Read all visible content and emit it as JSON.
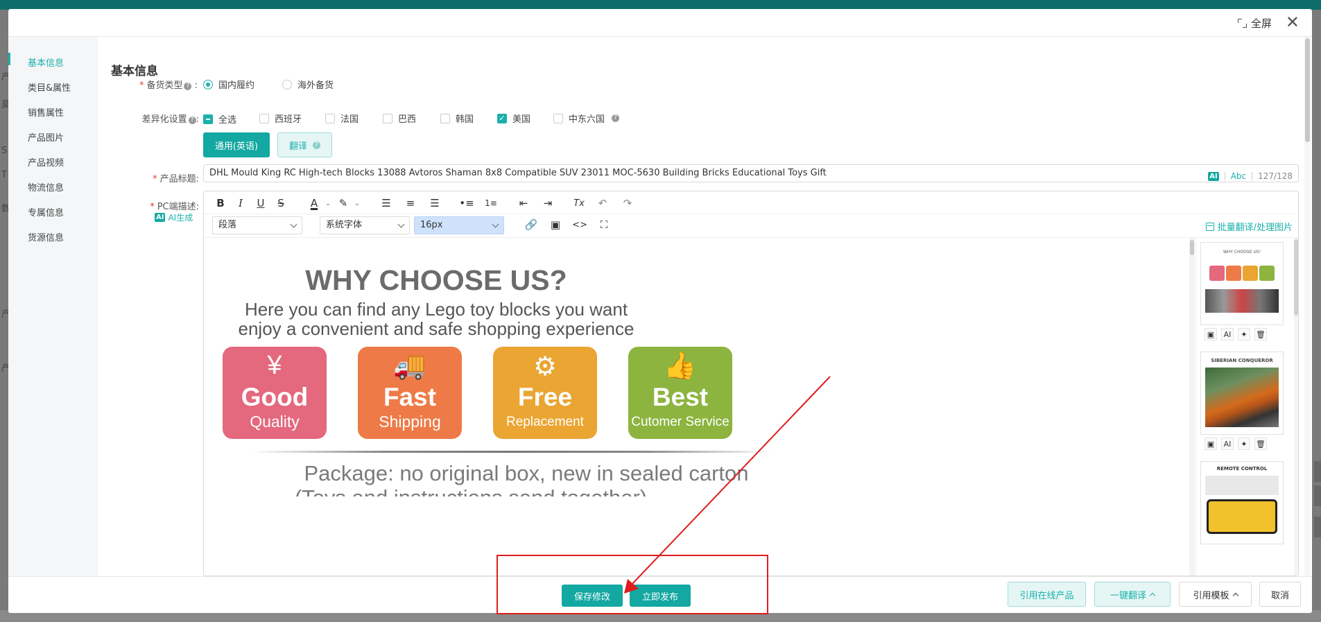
{
  "modal": {
    "fullscreen_label": "全屏",
    "close_symbol": "✕"
  },
  "side_nav": {
    "items": [
      {
        "label": "基本信息",
        "active": true
      },
      {
        "label": "类目&属性",
        "active": false
      },
      {
        "label": "销售属性",
        "active": false
      },
      {
        "label": "产品图片",
        "active": false
      },
      {
        "label": "产品视频",
        "active": false
      },
      {
        "label": "物流信息",
        "active": false
      },
      {
        "label": "专属信息",
        "active": false
      },
      {
        "label": "货源信息",
        "active": false
      }
    ]
  },
  "form": {
    "section_title": "基本信息",
    "stock_type": {
      "label": "备货类型",
      "options": [
        "国内履约",
        "海外备货"
      ],
      "selected": "国内履约"
    },
    "diff_settings": {
      "label": "差异化设置",
      "options": [
        "全选",
        "西班牙",
        "法国",
        "巴西",
        "韩国",
        "美国",
        "中东六国"
      ],
      "checked": [
        "美国"
      ],
      "indeterminate": [
        "全选"
      ]
    },
    "lang_buttons": {
      "general": "通用(英语)",
      "translate": "翻译"
    },
    "product_title": {
      "label": "产品标题:",
      "value": "DHL Mould King RC High-tech Blocks 13088 Avtoros Shaman 8x8 Compatible SUV 23011 MOC-5630 Building Bricks Educational Toys Gift",
      "ai_badge": "AI",
      "abc": "Abc",
      "counter": "127/128"
    },
    "pc_desc": {
      "label": "PC端描述:",
      "ai_generate": "AI生成",
      "ai_badge": "AI"
    }
  },
  "editor": {
    "toolbar": {
      "bold": "B",
      "italic": "I",
      "underline": "U",
      "strike": "S",
      "font_color": "A",
      "clear_format": "Tx",
      "undo": "↶",
      "redo": "↷"
    },
    "paragraph_select": "段落",
    "font_family_select": "系统字体",
    "font_size_select": "16px",
    "batch_label": "批量翻译/处理图片",
    "content": {
      "headline": "WHY CHOOSE US?",
      "line1": "Here you can find any Lego toy blocks you want",
      "line2": "enjoy a convenient and safe shopping experience",
      "tiles": [
        {
          "glyph": "¥",
          "big": "Good",
          "small": "Quality",
          "color": "#e4687e"
        },
        {
          "glyph": "🚚",
          "big": "Fast",
          "small": "Shipping",
          "color": "#ee7a47"
        },
        {
          "glyph": "⚙",
          "big": "Free",
          "small": "Replacement",
          "color": "#eaa532"
        },
        {
          "glyph": "👍",
          "big": "Best",
          "small": "Cutomer Service",
          "color": "#8cb43f"
        }
      ],
      "package_line1": "Package: no original box, new in sealed carton",
      "package_line2": "(Toys and instructions send together)"
    },
    "thumbnail_tools": {
      "ai": "AI"
    },
    "thumb_texts": {
      "t1": "WHY CHOOSE US!",
      "t2": "SIBERIAN CONQUEROR",
      "t3": "REMOTE CONTROL"
    }
  },
  "footer": {
    "save_label": "保存修改",
    "publish_label": "立即发布",
    "ref_online_label": "引用在线产品",
    "one_click_translate_label": "一键翻译",
    "ref_template_label": "引用模板",
    "cancel_label": "取消"
  },
  "colors": {
    "accent": "#1ab1aa",
    "primary_button": "#13a8a1",
    "annotation_red": "#e01c1c"
  }
}
